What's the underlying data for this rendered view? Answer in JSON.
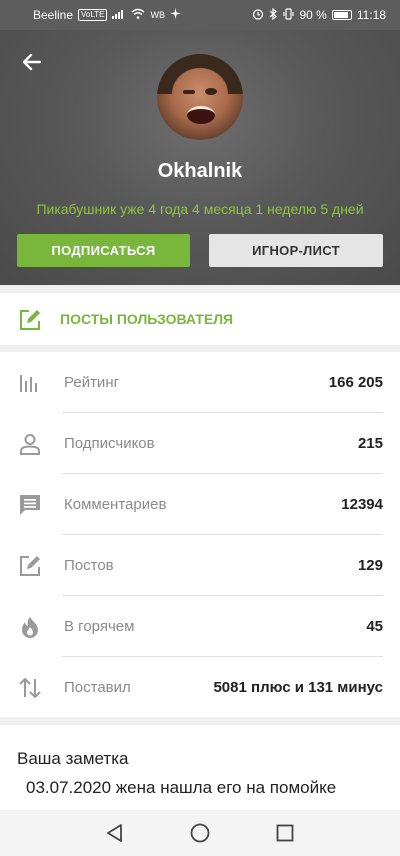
{
  "status_bar": {
    "carrier": "Beeline",
    "network_badge": "VoLTE",
    "extra": "WB",
    "battery": "90 %",
    "time": "11:18"
  },
  "profile": {
    "username": "Okhalnik",
    "tenure": "Пикабушник уже 4 года 4 месяца 1 неделю 5 дней",
    "subscribe_label": "ПОДПИСАТЬСЯ",
    "ignore_label": "ИГНОР-ЛИСТ"
  },
  "posts_link": {
    "label": "ПОСТЫ ПОЛЬЗОВАТЕЛЯ",
    "icon": "edit-icon"
  },
  "stats": [
    {
      "label": "Рейтинг",
      "value": "166 205",
      "icon": "bar-chart-icon"
    },
    {
      "label": "Подписчиков",
      "value": "215",
      "icon": "person-icon"
    },
    {
      "label": "Комментариев",
      "value": "12394",
      "icon": "comment-icon"
    },
    {
      "label": "Постов",
      "value": "129",
      "icon": "edit-icon"
    },
    {
      "label": "В горячем",
      "value": "45",
      "icon": "flame-icon"
    },
    {
      "label": "Поставил",
      "value": "5081 плюс и 131 минус",
      "icon": "sort-arrows-icon"
    }
  ],
  "note": {
    "title": "Ваша заметка",
    "text": "03.07.2020 жена нашла его на помойке"
  },
  "colors": {
    "accent": "#79b63c",
    "tenure": "#8ec63f",
    "header_bg": "#585858"
  }
}
